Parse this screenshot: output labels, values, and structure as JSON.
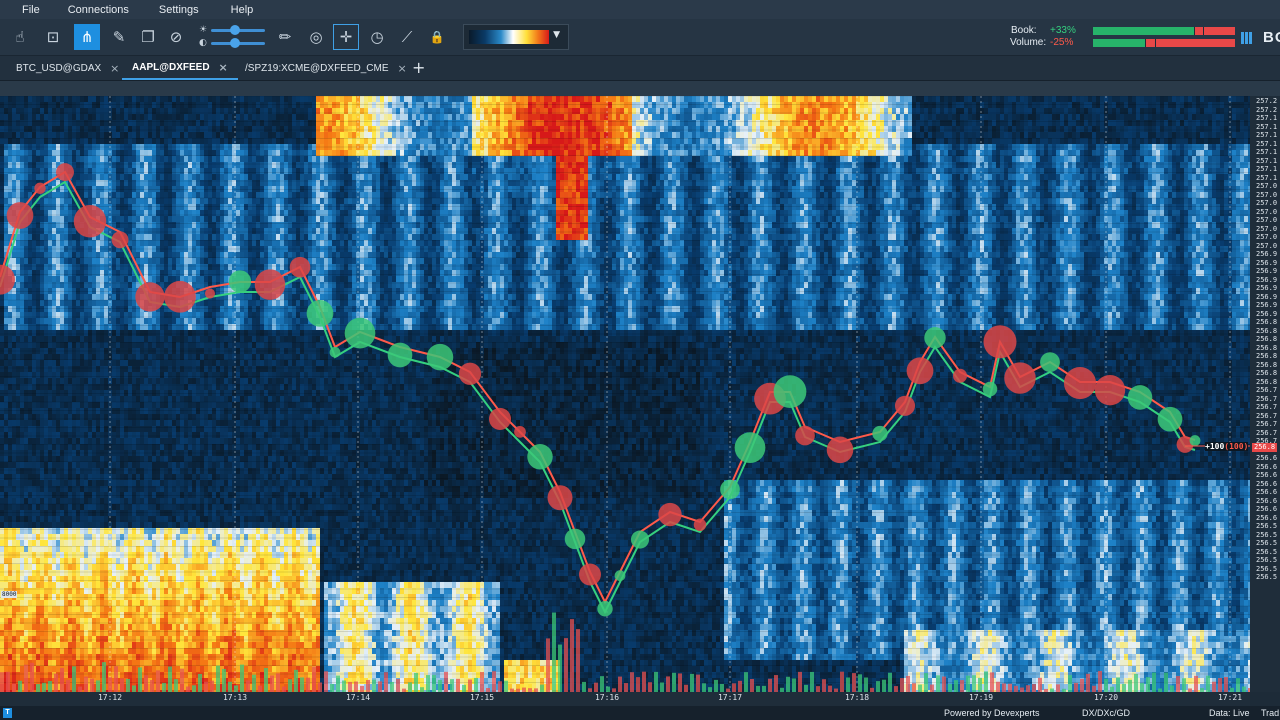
{
  "menu": [
    "File",
    "Connections",
    "Settings",
    "Help"
  ],
  "toolbar": {
    "tools": [
      {
        "name": "hand-tool-icon",
        "glyph": "☝"
      },
      {
        "name": "zoom-fit-icon",
        "glyph": "⊡"
      },
      {
        "name": "share-icon",
        "glyph": "⋔"
      },
      {
        "name": "pen-tool-icon",
        "glyph": "✎"
      },
      {
        "name": "layers-icon",
        "glyph": "❐"
      },
      {
        "name": "link-icon",
        "glyph": "⊘"
      },
      {
        "name": "pencil-icon",
        "glyph": "✏"
      },
      {
        "name": "comment-icon",
        "glyph": "◎"
      },
      {
        "name": "crosshair-icon",
        "glyph": "✛"
      },
      {
        "name": "timer-icon",
        "glyph": "◷"
      },
      {
        "name": "trend-icon",
        "glyph": "⟋"
      },
      {
        "name": "lock-icon",
        "glyph": "🔒"
      }
    ],
    "brightness_level": 0.45,
    "contrast_level": 0.45
  },
  "stats": {
    "book_label": "Book:",
    "book_value": "+33%",
    "volume_label": "Volume:",
    "volume_value": "-25%",
    "book_bar": {
      "green_fraction": 0.72,
      "secondary_green_fraction": 0.06
    },
    "volume_bar": {
      "green_fraction": 0.37,
      "secondary_green_fraction": 0.06
    }
  },
  "brand_text": "BO",
  "tabs": [
    {
      "label": "BTC_USD@GDAX",
      "active": false
    },
    {
      "label": "AAPL@DXFEED",
      "active": true
    },
    {
      "label": "/SPZ19:XCME@DXFEED_CME",
      "active": false
    }
  ],
  "chart": {
    "price_ticks": [
      "257.2",
      "257.2",
      "257.1",
      "257.1",
      "257.1",
      "257.1",
      "257.1",
      "257.1",
      "257.1",
      "257.1",
      "257.0",
      "257.0",
      "257.0",
      "257.0",
      "257.0",
      "257.0",
      "257.0",
      "257.0",
      "256.9",
      "256.9",
      "256.9",
      "256.9",
      "256.9",
      "256.9",
      "256.9",
      "256.9",
      "256.8",
      "256.8",
      "256.8",
      "256.8",
      "256.8",
      "256.8",
      "256.8",
      "256.8",
      "256.7",
      "256.7",
      "256.7",
      "256.7",
      "256.7",
      "256.7",
      "256.7",
      "256.7",
      "256.6",
      "256.6",
      "256.6",
      "256.6",
      "256.6",
      "256.6",
      "256.6",
      "256.6",
      "256.5",
      "256.5",
      "256.5",
      "256.5",
      "256.5",
      "256.5",
      "256.5"
    ],
    "time_ticks": [
      "17:12",
      "17:13",
      "17:14",
      "17:15",
      "17:16",
      "17:17",
      "17:18",
      "17:19",
      "17:20",
      "17:21"
    ],
    "current_price_prefix": "+100",
    "current_price_paren": "(100)",
    "axis_current_price": "256.8",
    "volume_label": "8000"
  },
  "status": {
    "powered_by": "Powered by Devexperts",
    "feed": "DX/DXc/GD",
    "data": "Data: Live",
    "trade": "Trad"
  }
}
